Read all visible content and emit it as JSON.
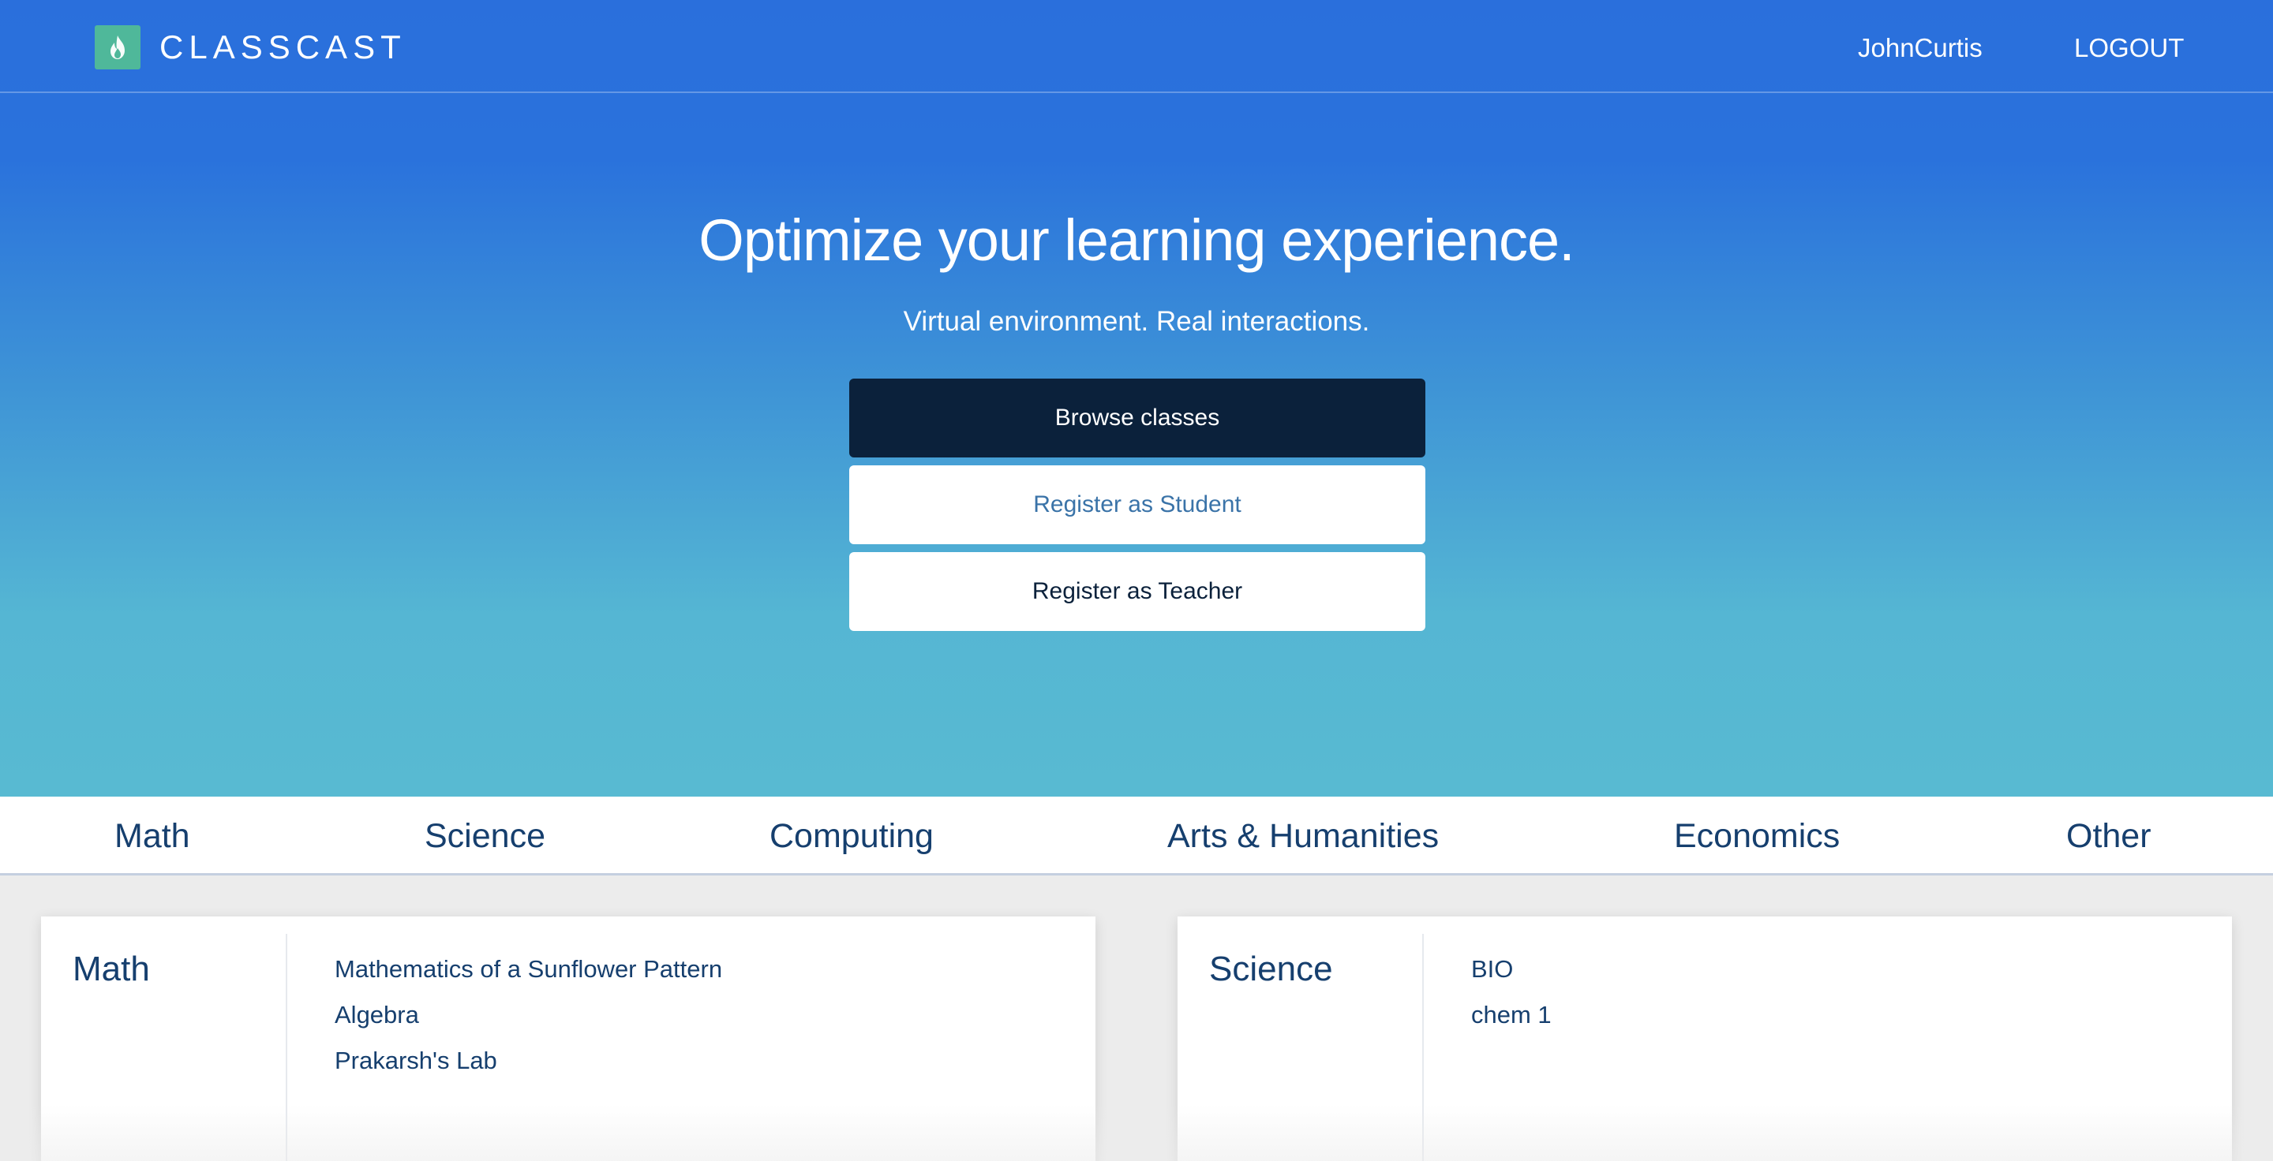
{
  "header": {
    "logo_text": "CLASSCAST",
    "logo_icon": "flame-icon",
    "user_name": "JohnCurtis",
    "logout_label": "LOGOUT"
  },
  "hero": {
    "title": "Optimize your learning experience.",
    "subtitle": "Virtual environment. Real interactions.",
    "browse_label": "Browse classes",
    "register_student_label": "Register as Student",
    "register_teacher_label": "Register as Teacher"
  },
  "categories": [
    "Math",
    "Science",
    "Computing",
    "Arts & Humanities",
    "Economics",
    "Other"
  ],
  "cards": [
    {
      "title": "Math",
      "classes": [
        "Mathematics of a Sunflower Pattern",
        "Algebra",
        "Prakarsh's Lab"
      ]
    },
    {
      "title": "Science",
      "classes": [
        "BIO",
        "chem 1"
      ]
    }
  ],
  "colors": {
    "hero_top": "#2a6fdc",
    "hero_bottom": "#58bad2",
    "dark_navy": "#0b213b",
    "logo_green": "#4fb89a",
    "link_blue": "#163f6e"
  }
}
